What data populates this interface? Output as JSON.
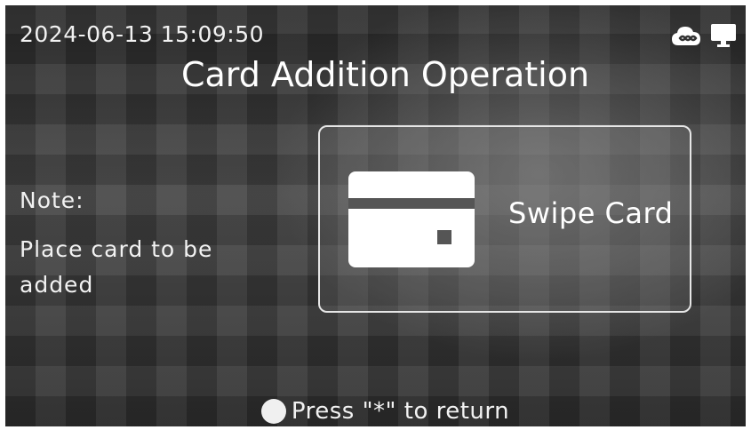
{
  "status_bar": {
    "datetime": "2024-06-13  15:09:50",
    "icons": [
      "cloud-link-icon",
      "monitor-icon"
    ]
  },
  "title": "Card Addition Operation",
  "note": {
    "label": "Note:",
    "text": "Place card to be added"
  },
  "swipe_panel": {
    "icon": "card-icon",
    "label": "Swipe Card"
  },
  "footer": {
    "hint": "Press \"*\" to return",
    "icon": "circle-icon"
  }
}
